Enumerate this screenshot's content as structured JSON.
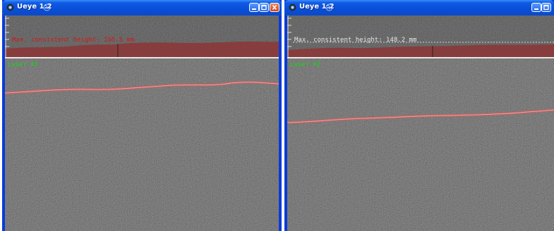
{
  "windows": [
    {
      "title": "Ueye 1:2",
      "max_height_text": "Max. consistent height: 165.5 mm",
      "laser_label": "Laser #1"
    },
    {
      "title": "Ueye 1:2",
      "max_height_text": "Max. consistent height: 148.2 mm",
      "laser_label": "Laser #2"
    }
  ],
  "colors": {
    "titlebar": "#0a4fd8",
    "height_fill": "#8a3a3a",
    "laser_line": "#e05a5a",
    "laser_label": "#18d418",
    "height_label_1": "#d21818",
    "height_label_2": "#e6e6e6"
  },
  "icons": [
    "app-icon",
    "title-sub-icon",
    "minimize-icon",
    "maximize-icon",
    "close-icon"
  ]
}
